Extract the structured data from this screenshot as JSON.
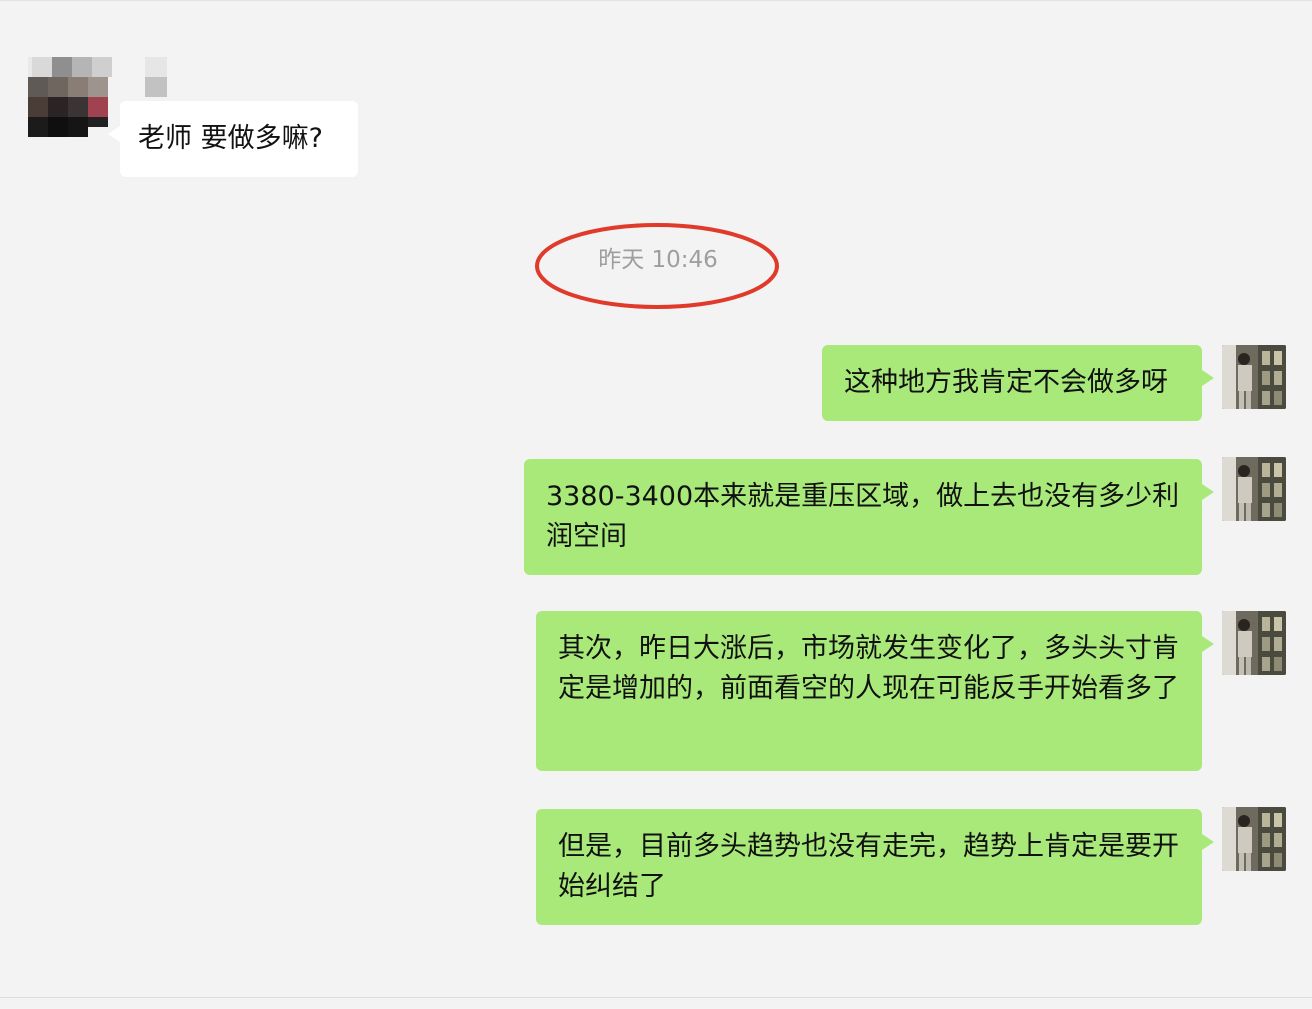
{
  "conversation": {
    "incoming": {
      "text": "老师 要做多嘛?"
    },
    "timestamp": "昨天 10:46",
    "outgoing": [
      {
        "text": "这种地方我肯定不会做多呀"
      },
      {
        "text": "3380-3400本来就是重压区域，做上去也没有多少利润空间"
      },
      {
        "text": "其次，昨日大涨后，市场就发生变化了，多头头寸肯定是增加的，前面看空的人现在可能反手开始看多了"
      },
      {
        "text": "但是，目前多头趋势也没有走完，趋势上肯定是要开始纠结了"
      }
    ]
  },
  "colors": {
    "background": "#f3f3f3",
    "incoming_bubble": "#ffffff",
    "outgoing_bubble": "#a9e97a",
    "highlight_ellipse": "#e03a2a",
    "timestamp_text": "#9e9e9e"
  },
  "icons": {
    "incoming_avatar": "pixelated-avatar-icon",
    "outgoing_avatar": "user-photo-avatar-icon"
  }
}
